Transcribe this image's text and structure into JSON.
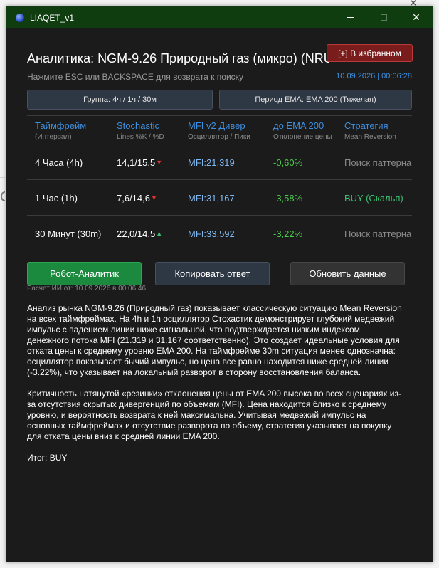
{
  "window": {
    "title": "LIAQET_v1",
    "controls": {
      "minimize": "–",
      "maximize": "☐",
      "close": "✕"
    }
  },
  "header": {
    "title": "Аналитика: NGM-9.26 Природный газ (микро) (NRU",
    "favorite_button": "[+] В избранном",
    "hint": "Нажмите ESC или BACKSPACE для возврата к поиску",
    "timestamp": "10.09.2026 | 00:06:28"
  },
  "selectors": {
    "group": "Группа: 4ч / 1ч / 30м",
    "ema_period": "Период EMA: EMA 200 (Тяжелая)"
  },
  "table": {
    "columns": [
      {
        "title": "Таймфрейм",
        "subtitle": "(Интервал)"
      },
      {
        "title": "Stochastic",
        "subtitle": "Lines %K / %D"
      },
      {
        "title": "MFI v2 Дивер",
        "subtitle": "Осциллятор / Пики"
      },
      {
        "title": "до EMA 200",
        "subtitle": "Отклонение цены"
      },
      {
        "title": "Стратегия",
        "subtitle": "Mean Reversion"
      }
    ],
    "rows": [
      {
        "timeframe": "4 Часа (4h)",
        "stochastic": "14,1/15,5",
        "stoch_arrow": "▼",
        "mfi": "MFI:21,319",
        "ema_dev": "-0,60%",
        "strategy": "Поиск паттерна"
      },
      {
        "timeframe": "1 Час (1h)",
        "stochastic": "7,6/14,6",
        "stoch_arrow": "▼",
        "mfi": "MFI:31,167",
        "ema_dev": "-3,58%",
        "strategy": "BUY (Скальп)"
      },
      {
        "timeframe": "30 Минут (30m)",
        "stochastic": "22,0/14,5",
        "stoch_arrow": "▲",
        "mfi": "MFI:33,592",
        "ema_dev": "-3,22%",
        "strategy": "Поиск паттерна"
      }
    ]
  },
  "actions": {
    "robot": "Робот-Аналитик",
    "copy": "Копировать ответ",
    "refresh": "Обновить данные"
  },
  "calc_time": "Расчет ИИ от: 10.09.2026 в 00:06:46",
  "analysis": {
    "paragraph1": "Анализ рынка NGM-9.26 (Природный газ) показывает классическую ситуацию Mean Reversion на всех таймфреймах. На 4h и 1h осциллятор Стохастик демонстрирует глубокий медвежий импульс с падением линии ниже сигнальной, что подтверждается низким индексом денежного потока MFI (21.319 и 31.167 соответственно). Это создает идеальные условия для отката цены к среднему уровню EMA 200. На таймфрейме 30m ситуация менее однозначна: осциллятор показывает бычий импульс, но цена все равно находится ниже средней линии (-3.22%), что указывает на локальный разворот в сторону восстановления баланса.",
    "paragraph2": "Критичность натянутой «резинки» отклонения цены от EMA 200 высока во всех сценариях из-за отсутствия скрытых дивергенций по объемам (MFI). Цена находится близко к среднему уровню, и вероятность возврата к ней максимальна. Учитывая медвежий импульс на основных таймфреймах и отсутствие разворота по объему, стратегия указывает на покупку для отката цены вниз к средней линии EMA 200.",
    "verdict": "Итог: BUY"
  },
  "colors": {
    "titlebar": "#0f3d0f",
    "background": "#1b1b1b",
    "accent_blue": "#3d8fe0",
    "green": "#4cc84c",
    "red": "#e03030",
    "favorite_bg": "#7a1c1c"
  },
  "background_app": {
    "close_glyph": "✕",
    "edge_letter": "C"
  }
}
